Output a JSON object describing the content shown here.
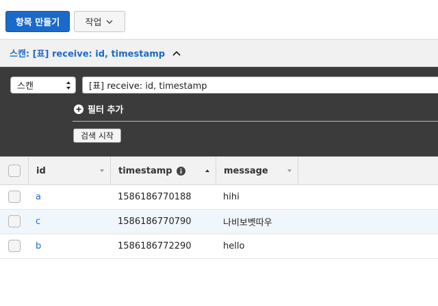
{
  "toolbar": {
    "create_item_label": "항목 만들기",
    "actions_label": "작업"
  },
  "scan_header": {
    "title": "스캔: [표] receive: id, timestamp"
  },
  "query_panel": {
    "mode_value": "스캔",
    "table_value": "[표] receive: id, timestamp",
    "add_filter_label": "필터 추가",
    "start_search_label": "검색 시작"
  },
  "table": {
    "columns": [
      {
        "label": "id"
      },
      {
        "label": "timestamp"
      },
      {
        "label": "message"
      }
    ],
    "rows": [
      {
        "id": "a",
        "timestamp": "1586186770188",
        "message": "hihi"
      },
      {
        "id": "c",
        "timestamp": "1586186770790",
        "message": "나비보벳따우"
      },
      {
        "id": "b",
        "timestamp": "1586186772290",
        "message": "hello"
      }
    ]
  },
  "colors": {
    "primary": "#1b6ac9",
    "panel_bg": "#3b3b3b",
    "header_bg": "#f1f1f1",
    "selected_row_bg": "#f0f7fc"
  }
}
